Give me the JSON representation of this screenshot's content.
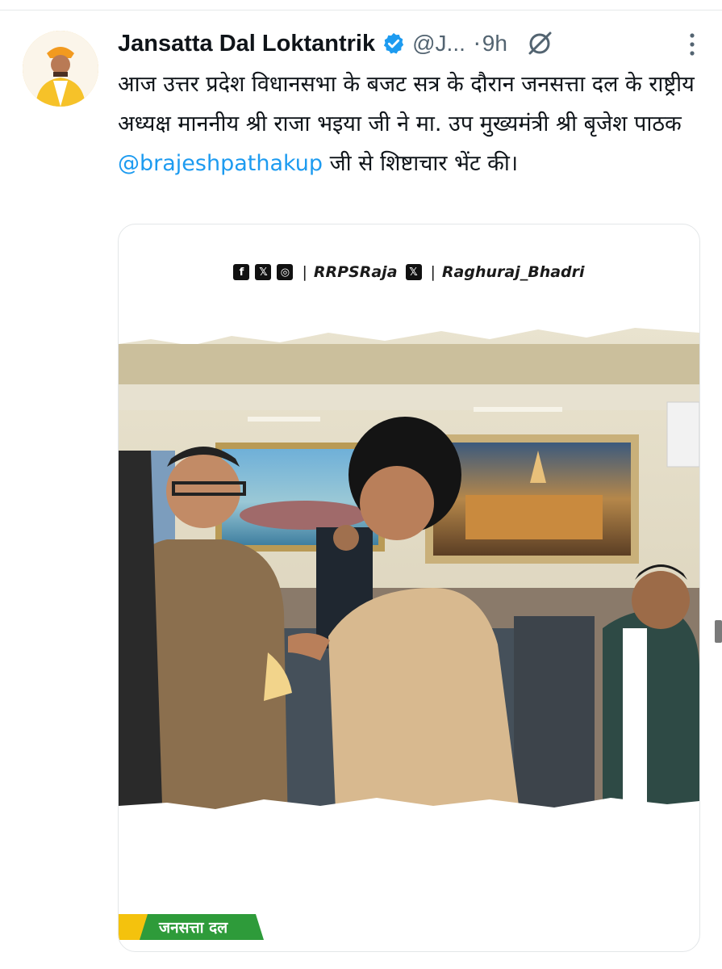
{
  "tweet": {
    "display_name": "Jansatta Dal Loktantrik",
    "handle": "@J...",
    "separator": "·",
    "time": "9h",
    "text_parts": {
      "before": "आज उत्तर प्रदेश विधानसभा के बजट सत्र के दौरान जनसत्ता दल के राष्ट्रीय अध्यक्ष माननीय श्री राजा भइया जी ने मा. उप मुख्यमंत्री श्री बृजेश पाठक ",
      "mention": "@brajeshpathakup",
      "after": " जी से शिष्टाचार भेंट की।"
    }
  },
  "icons": {
    "verified": "verified-badge-icon",
    "grok": "grok-icon",
    "more": "more-options-icon",
    "colors": {
      "verified": "#1d9bf0",
      "mention": "#1d9bf0",
      "text": "#0f1419",
      "muted": "#536471"
    }
  },
  "media": {
    "social_handle_1": "RRPSRaja",
    "social_handle_2": "Raghuraj_Bhadri",
    "social_sep": "|",
    "fb_glyph": "f",
    "x_glyph": "𝕏",
    "ig_glyph": "◎",
    "brand_label": "जनसत्ता दल",
    "brand_colors": {
      "green": "#2e9b3a",
      "yellow": "#f4c20d"
    }
  }
}
